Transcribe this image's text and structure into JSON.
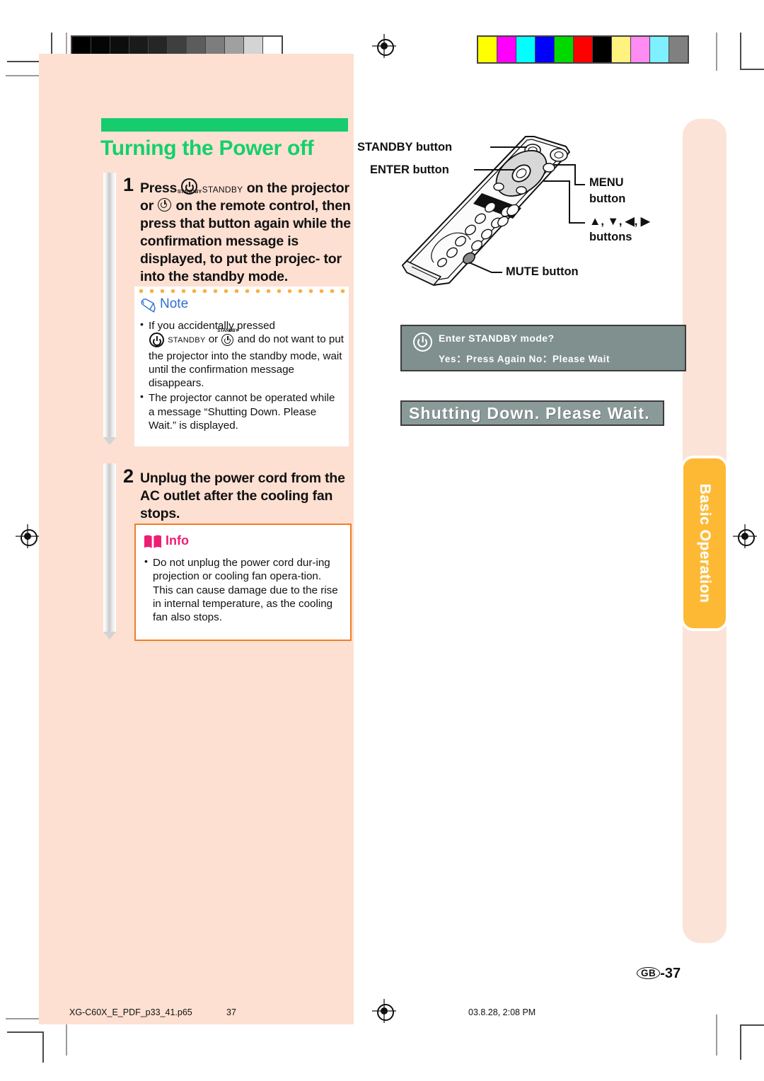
{
  "document": {
    "section_tab": "Basic Operation",
    "page_label": "GB",
    "page_number": "-37"
  },
  "heading": {
    "title": "Turning the Power off"
  },
  "steps": [
    {
      "number": "1",
      "text_lead": "Press",
      "icon_projector": "power-standby-icon",
      "icon_projector_sub": "STANDBY",
      "standby_caption": "STANDBY",
      "text_mid": "on the projector",
      "text_or": "or",
      "icon_remote": "power-standby-icon",
      "text_tail": "on the remote control, then press that button again while the confirmation message is displayed, to put the projec- tor into the standby mode."
    },
    {
      "number": "2",
      "text": "Unplug the power cord from the AC outlet after the cooling fan stops."
    }
  ],
  "note": {
    "icon": "pencil-icon",
    "title": "Note",
    "items": [
      {
        "lead": "If you accidentally pressed",
        "icon_projector": "power-standby-icon",
        "standby_caption": "STANDBY",
        "or": "or",
        "icon_remote": "power-standby-icon",
        "tail": "and do not want to put the projector into the standby mode, wait until the confirmation message disappears."
      },
      {
        "text": "The projector cannot be operated while a message “Shutting Down. Please Wait.” is displayed."
      }
    ]
  },
  "info": {
    "icon": "open-book-icon",
    "title": "Info",
    "items": [
      "Do not unplug the power cord dur-ing projection or cooling fan opera-tion. This can cause damage due to the rise in internal temperature, as the cooling fan also stops."
    ]
  },
  "figure": {
    "alt": "remote-control-illustration",
    "callouts": [
      {
        "name": "standby-button",
        "label": "STANDBY button"
      },
      {
        "name": "enter-button",
        "label": "ENTER button"
      },
      {
        "name": "menu-button",
        "label": "MENU"
      },
      {
        "name": "menu-button-line2",
        "label": "button"
      },
      {
        "name": "arrow-buttons",
        "label": "▲, ▼, ◀, ▶"
      },
      {
        "name": "arrow-buttons-line2",
        "label": "buttons"
      },
      {
        "name": "mute-button",
        "label": "MUTE button"
      }
    ]
  },
  "osd": {
    "confirm": {
      "icon": "power-standby-icon",
      "line1": "Enter STANDBY mode?",
      "line2": "Yes：Press Again  No：Please Wait"
    },
    "shutdown": {
      "text": "Shutting Down. Please Wait."
    }
  },
  "footer": {
    "filename": "XG-C60X_E_PDF_p33_41.p65",
    "folio": "37",
    "timestamp": "03.8.28, 2:08 PM"
  },
  "colors": {
    "panel_pink": "#fde0d2",
    "heading_green": "#13d06b",
    "tab_orange": "#fdb933",
    "note_blue": "#2f6fd0",
    "info_pink": "#ee1d74",
    "info_border": "#f07f24",
    "osd_gray": "#7f908e"
  },
  "calibration": {
    "grayscale": [
      "#000000",
      "#050505",
      "#0d0d0d",
      "#1a1a1a",
      "#262626",
      "#3f3f3f",
      "#5c5c5c",
      "#7d7d7d",
      "#a0a0a0",
      "#d4d4d4",
      "#ffffff"
    ],
    "color": [
      "#ffff00",
      "#ff00ff",
      "#00ffff",
      "#0000ff",
      "#00d900",
      "#ff0000",
      "#000000",
      "#fff27f",
      "#ff8cf2",
      "#7ff0ff",
      "#808080"
    ]
  }
}
